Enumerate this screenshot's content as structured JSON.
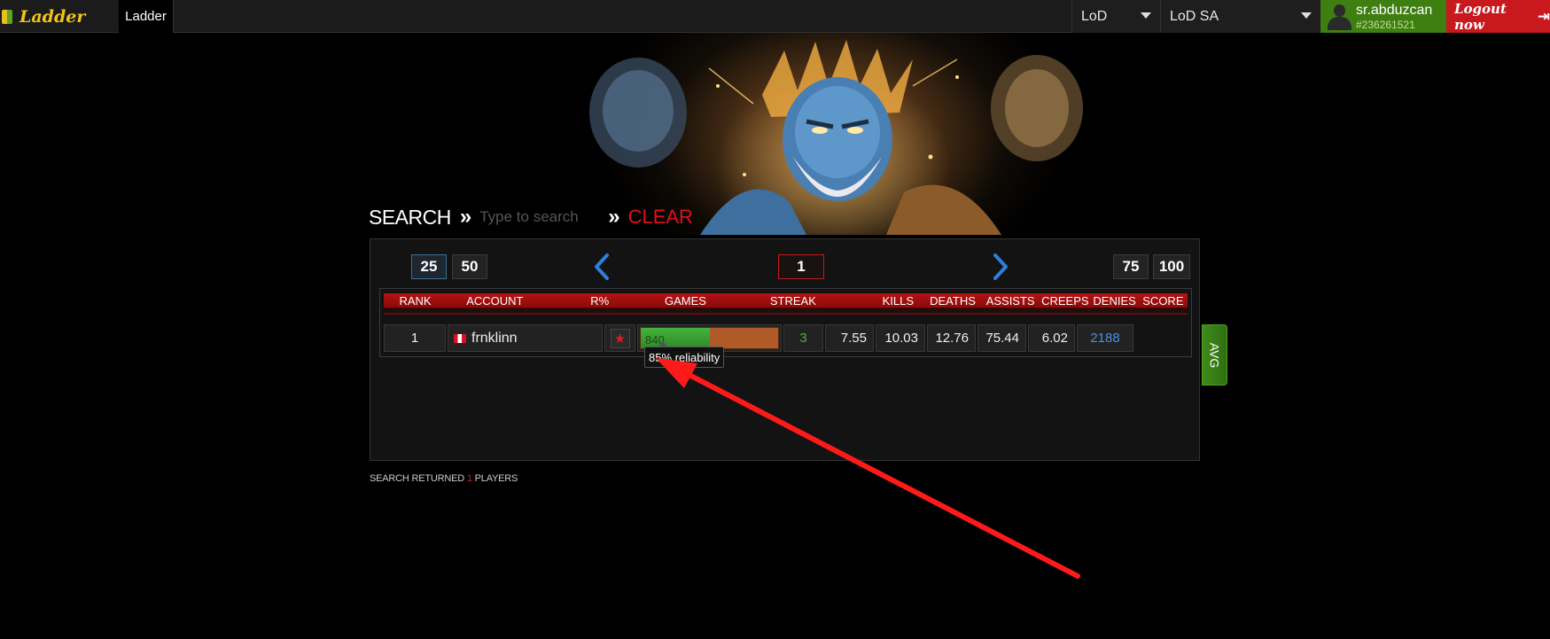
{
  "topbar": {
    "logo_text": "Ladder",
    "active_tab": "Ladder",
    "mode_select": "LoD",
    "region_select": "LoD SA",
    "user_name": "sr.abduzcan",
    "user_id": "#236261521",
    "logout_label": "Logout now"
  },
  "search": {
    "label": "SEARCH",
    "separator": "»",
    "placeholder": "Type to search",
    "clear_label": "CLEAR"
  },
  "pagination": {
    "sizes": [
      "25",
      "50",
      "75",
      "100"
    ],
    "current_page": "1",
    "active_size": "25"
  },
  "table": {
    "columns": [
      "RANK",
      "ACCOUNT",
      "R%",
      "GAMES",
      "STREAK",
      "KILLS",
      "DEATHS",
      "ASSISTS",
      "CREEPS",
      "DENIES",
      "SCORE"
    ],
    "rows": [
      {
        "rank": "1",
        "account": "frnklinn",
        "games": "840",
        "games_win_fraction": 0.5,
        "streak": "3",
        "kills": "7.55",
        "deaths": "10.03",
        "assists": "12.76",
        "creeps": "75.44",
        "denies": "6.02",
        "score": "2188"
      }
    ]
  },
  "tooltip": "85% reliability",
  "avg_tab": "AVG",
  "results": {
    "prefix": "SEARCH RETURNED",
    "count": "1",
    "suffix": "PLAYERS"
  },
  "colors": {
    "accent_red": "#c8191e",
    "user_green": "#3f7f12",
    "score_blue": "#4a8ee0",
    "annotation_red": "#ff1a1a"
  }
}
